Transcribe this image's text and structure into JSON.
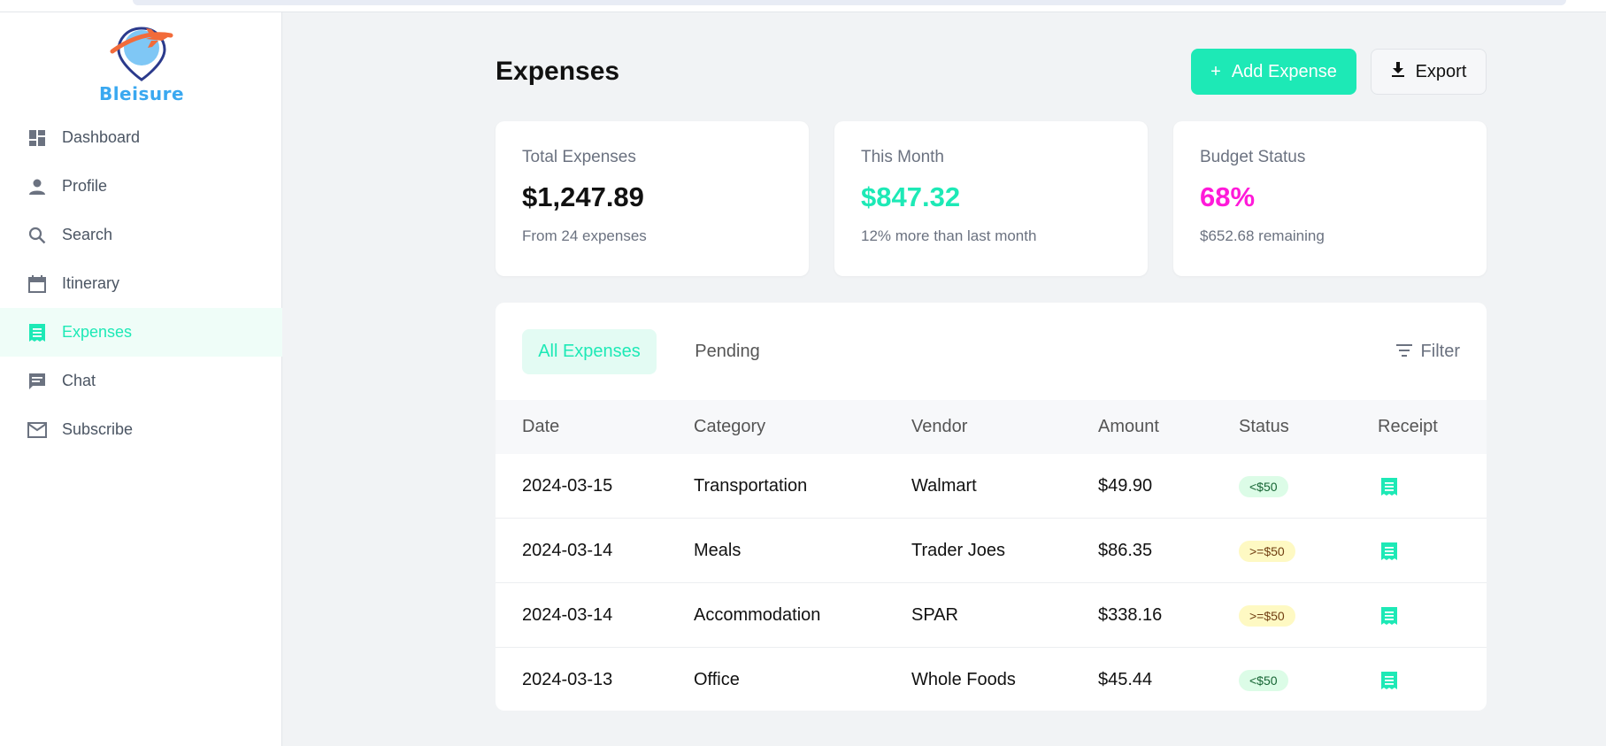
{
  "app": {
    "logo_text": "Bleisure"
  },
  "sidebar": {
    "items": [
      {
        "label": "Dashboard",
        "icon": "dashboard-icon"
      },
      {
        "label": "Profile",
        "icon": "person-icon"
      },
      {
        "label": "Search",
        "icon": "search-icon"
      },
      {
        "label": "Itinerary",
        "icon": "calendar-icon"
      },
      {
        "label": "Expenses",
        "icon": "receipt-icon",
        "active": true
      },
      {
        "label": "Chat",
        "icon": "chat-icon"
      },
      {
        "label": "Subscribe",
        "icon": "mail-icon"
      }
    ]
  },
  "header": {
    "title": "Expenses",
    "add_label": "Add Expense",
    "add_icon": "+",
    "export_label": "Export"
  },
  "stats": [
    {
      "label": "Total Expenses",
      "value": "$1,247.89",
      "note": "From 24 expenses",
      "color": "#111111"
    },
    {
      "label": "This Month",
      "value": "$847.32",
      "note": "12% more than last month",
      "color": "#1de9b6"
    },
    {
      "label": "Budget Status",
      "value": "68%",
      "note": "$652.68 remaining",
      "color": "#ff1ad9"
    }
  ],
  "tabs": {
    "all_label": "All Expenses",
    "pending_label": "Pending",
    "filter_label": "Filter"
  },
  "table": {
    "columns": [
      "Date",
      "Category",
      "Vendor",
      "Amount",
      "Status",
      "Receipt"
    ],
    "rows": [
      {
        "date": "2024-03-15",
        "category": "Transportation",
        "vendor": "Walmart",
        "amount": "$49.90",
        "status": "<$50"
      },
      {
        "date": "2024-03-14",
        "category": "Meals",
        "vendor": "Trader Joes",
        "amount": "$86.35",
        "status": ">=$50"
      },
      {
        "date": "2024-03-14",
        "category": "Accommodation",
        "vendor": "SPAR",
        "amount": "$338.16",
        "status": ">=$50"
      },
      {
        "date": "2024-03-13",
        "category": "Office",
        "vendor": "Whole Foods",
        "amount": "$45.44",
        "status": "<$50"
      }
    ]
  },
  "colors": {
    "accent": "#1de9b6",
    "magenta": "#ff1ad9",
    "logo_blue": "#3aa8f0"
  }
}
